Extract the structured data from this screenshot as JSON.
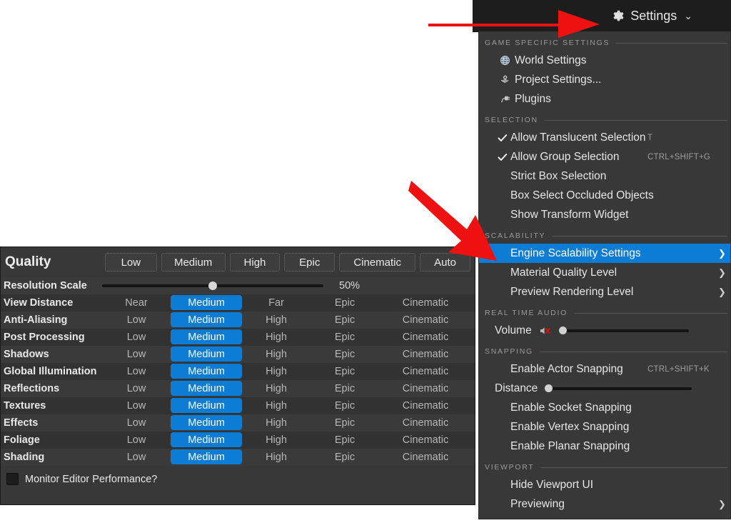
{
  "menu": {
    "header": {
      "title": "Settings",
      "gear_icon": "gear-icon",
      "chevron": "⌄"
    },
    "sections": [
      {
        "title": "GAME SPECIFIC SETTINGS",
        "items": [
          {
            "label": "World Settings",
            "icon": "globe-icon",
            "checked": false,
            "shortcut": "",
            "submenu": false
          },
          {
            "label": "Project Settings...",
            "icon": "project-settings-icon",
            "checked": false,
            "shortcut": "",
            "submenu": false
          },
          {
            "label": "Plugins",
            "icon": "plug-icon",
            "checked": false,
            "shortcut": "",
            "submenu": false
          }
        ]
      },
      {
        "title": "SELECTION",
        "items": [
          {
            "label": "Allow Translucent Selection",
            "icon": "",
            "checked": true,
            "shortcut": "T",
            "submenu": false
          },
          {
            "label": "Allow Group Selection",
            "icon": "",
            "checked": true,
            "shortcut": "CTRL+SHIFT+G",
            "submenu": false
          },
          {
            "label": "Strict Box Selection",
            "icon": "",
            "checked": false,
            "shortcut": "",
            "submenu": false
          },
          {
            "label": "Box Select Occluded Objects",
            "icon": "",
            "checked": false,
            "shortcut": "",
            "submenu": false
          },
          {
            "label": "Show Transform Widget",
            "icon": "",
            "checked": false,
            "shortcut": "",
            "submenu": false
          }
        ]
      },
      {
        "title": "SCALABILITY",
        "items": [
          {
            "label": "Engine Scalability Settings",
            "icon": "",
            "checked": false,
            "shortcut": "",
            "submenu": true,
            "selected": true
          },
          {
            "label": "Material Quality Level",
            "icon": "",
            "checked": false,
            "shortcut": "",
            "submenu": true
          },
          {
            "label": "Preview Rendering Level",
            "icon": "",
            "checked": false,
            "shortcut": "",
            "submenu": true
          }
        ]
      },
      {
        "title": "REAL TIME AUDIO",
        "slider_item": {
          "label": "Volume",
          "icon": "speaker-muted-icon",
          "knob_percent": 0
        }
      },
      {
        "title": "SNAPPING",
        "items": [
          {
            "label": "Enable Actor Snapping",
            "icon": "",
            "checked": false,
            "shortcut": "CTRL+SHIFT+K",
            "submenu": false
          }
        ],
        "slider_item": {
          "label": "Distance",
          "icon": "",
          "knob_percent": 0
        },
        "items_after": [
          {
            "label": "Enable Socket Snapping",
            "icon": "",
            "checked": false,
            "shortcut": "",
            "submenu": false
          },
          {
            "label": "Enable Vertex Snapping",
            "icon": "",
            "checked": false,
            "shortcut": "",
            "submenu": false
          },
          {
            "label": "Enable Planar Snapping",
            "icon": "",
            "checked": false,
            "shortcut": "",
            "submenu": false
          }
        ]
      },
      {
        "title": "VIEWPORT",
        "items": [
          {
            "label": "Hide Viewport UI",
            "icon": "",
            "checked": false,
            "shortcut": "",
            "submenu": false
          },
          {
            "label": "Previewing",
            "icon": "",
            "checked": false,
            "shortcut": "",
            "submenu": true
          }
        ]
      }
    ]
  },
  "quality": {
    "title": "Quality",
    "presets": [
      "Low",
      "Medium",
      "High",
      "Epic",
      "Cinematic",
      "Auto"
    ],
    "resolution_scale": {
      "label": "Resolution Scale",
      "value": "50%",
      "knob_percent": 50
    },
    "rows": [
      {
        "label": "View Distance",
        "options": [
          "Near",
          "Medium",
          "Far",
          "Epic",
          "Cinematic"
        ],
        "selected": 1
      },
      {
        "label": "Anti-Aliasing",
        "options": [
          "Low",
          "Medium",
          "High",
          "Epic",
          "Cinematic"
        ],
        "selected": 1
      },
      {
        "label": "Post Processing",
        "options": [
          "Low",
          "Medium",
          "High",
          "Epic",
          "Cinematic"
        ],
        "selected": 1
      },
      {
        "label": "Shadows",
        "options": [
          "Low",
          "Medium",
          "High",
          "Epic",
          "Cinematic"
        ],
        "selected": 1
      },
      {
        "label": "Global Illumination",
        "options": [
          "Low",
          "Medium",
          "High",
          "Epic",
          "Cinematic"
        ],
        "selected": 1
      },
      {
        "label": "Reflections",
        "options": [
          "Low",
          "Medium",
          "High",
          "Epic",
          "Cinematic"
        ],
        "selected": 1
      },
      {
        "label": "Textures",
        "options": [
          "Low",
          "Medium",
          "High",
          "Epic",
          "Cinematic"
        ],
        "selected": 1
      },
      {
        "label": "Effects",
        "options": [
          "Low",
          "Medium",
          "High",
          "Epic",
          "Cinematic"
        ],
        "selected": 1
      },
      {
        "label": "Foliage",
        "options": [
          "Low",
          "Medium",
          "High",
          "Epic",
          "Cinematic"
        ],
        "selected": 1
      },
      {
        "label": "Shading",
        "options": [
          "Low",
          "Medium",
          "High",
          "Epic",
          "Cinematic"
        ],
        "selected": 1
      }
    ],
    "footer": {
      "label": "Monitor Editor Performance?",
      "checked": false
    }
  },
  "annotations": {
    "arrow_color": "#ee1111",
    "arrows": [
      "settings-button-arrow",
      "engine-scalability-arrow"
    ]
  },
  "colors": {
    "accent": "#0c7cd5",
    "panel_bg": "#383838",
    "menu_bg": "#383838",
    "topbar_bg": "#1d1d1d",
    "arrow": "#ee1111"
  }
}
